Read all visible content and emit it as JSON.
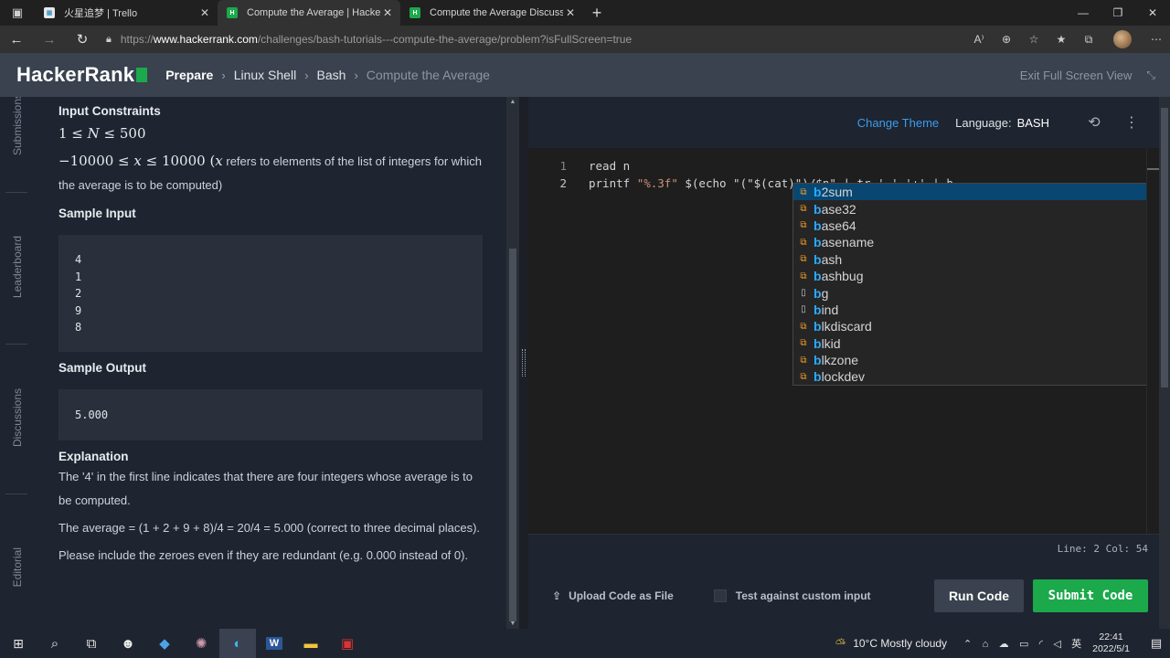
{
  "browser": {
    "tabs": [
      {
        "title": "火星追梦 | Trello",
        "favicon": "trello-icon",
        "active": false
      },
      {
        "title": "Compute the Average | HackerR",
        "favicon": "hackerrank-icon",
        "active": true
      },
      {
        "title": "Compute the Average Discussio",
        "favicon": "hackerrank-icon",
        "active": false
      }
    ],
    "url_prefix": "https://",
    "url_host": "www.hackerrank.com",
    "url_path": "/challenges/bash-tutorials---compute-the-average/problem?isFullScreen=true",
    "new_tab_glyph": "+",
    "win_minimize": "—",
    "win_maximize": "❐",
    "win_close": "✕"
  },
  "header": {
    "logo": "HackerRank",
    "breadcrumbs": [
      "Prepare",
      "Linux Shell",
      "Bash",
      "Compute the Average"
    ],
    "exit_fullscreen": "Exit Full Screen View"
  },
  "rail": {
    "items": [
      "Submissions",
      "Leaderboard",
      "Discussions",
      "Editorial"
    ]
  },
  "problem": {
    "constraints_title": "Input Constraints",
    "constraint1": "1 ≤ 𝑁 ≤ 500",
    "constraint2_math": "−10000 ≤ 𝑥 ≤ 10000",
    "constraint2_text_a": " (",
    "constraint2_var": "𝑥",
    "constraint2_text_b": " refers to elements of the list of integers for which the average is to be computed)",
    "sample_input_title": "Sample Input",
    "sample_input": [
      "4",
      "1",
      "2",
      "9",
      "8"
    ],
    "sample_output_title": "Sample Output",
    "sample_output": "5.000",
    "explanation_title": "Explanation",
    "explanation_1": "The '4' in the first line indicates that there are four integers whose average is to be computed.",
    "explanation_2": "The average = (1 + 2 + 9 + 8)/4 = 20/4 = 5.000 (correct to three decimal places).",
    "explanation_3": "Please include the zeroes even if they are redundant (e.g. 0.000 instead of 0)."
  },
  "editor": {
    "change_theme": "Change Theme",
    "language_label": "Language:",
    "language": "BASH",
    "lines": [
      {
        "num": "1",
        "code": "read n"
      },
      {
        "num": "2",
        "code_a": "printf ",
        "code_str": "\"%.3f\"",
        "code_b": " $(echo \"(\"$(cat)\")/$n\" | tr ' ' '+' | b"
      }
    ],
    "suggestions": [
      {
        "match": "b",
        "rest": "2sum",
        "kind": "module"
      },
      {
        "match": "b",
        "rest": "ase32",
        "kind": "module"
      },
      {
        "match": "b",
        "rest": "ase64",
        "kind": "module"
      },
      {
        "match": "b",
        "rest": "asename",
        "kind": "module"
      },
      {
        "match": "b",
        "rest": "ash",
        "kind": "module"
      },
      {
        "match": "b",
        "rest": "ashbug",
        "kind": "module"
      },
      {
        "match": "b",
        "rest": "g",
        "kind": "keyword"
      },
      {
        "match": "b",
        "rest": "ind",
        "kind": "keyword"
      },
      {
        "match": "b",
        "rest": "lkdiscard",
        "kind": "module"
      },
      {
        "match": "b",
        "rest": "lkid",
        "kind": "module"
      },
      {
        "match": "b",
        "rest": "lkzone",
        "kind": "module"
      },
      {
        "match": "b",
        "rest": "lockdev",
        "kind": "module"
      }
    ],
    "status": "Line: 2 Col: 54",
    "upload": "Upload Code as File",
    "custom_input": "Test against custom input",
    "run": "Run Code",
    "submit": "Submit Code"
  },
  "taskbar": {
    "weather": "10°C  Mostly cloudy",
    "ime": "英",
    "time": "22:41",
    "date": "2022/5/1"
  },
  "colors": {
    "brand_green": "#1ba94c",
    "header_bg": "#39424e",
    "link_blue": "#3b9ded",
    "match_blue": "#2aaaff"
  }
}
